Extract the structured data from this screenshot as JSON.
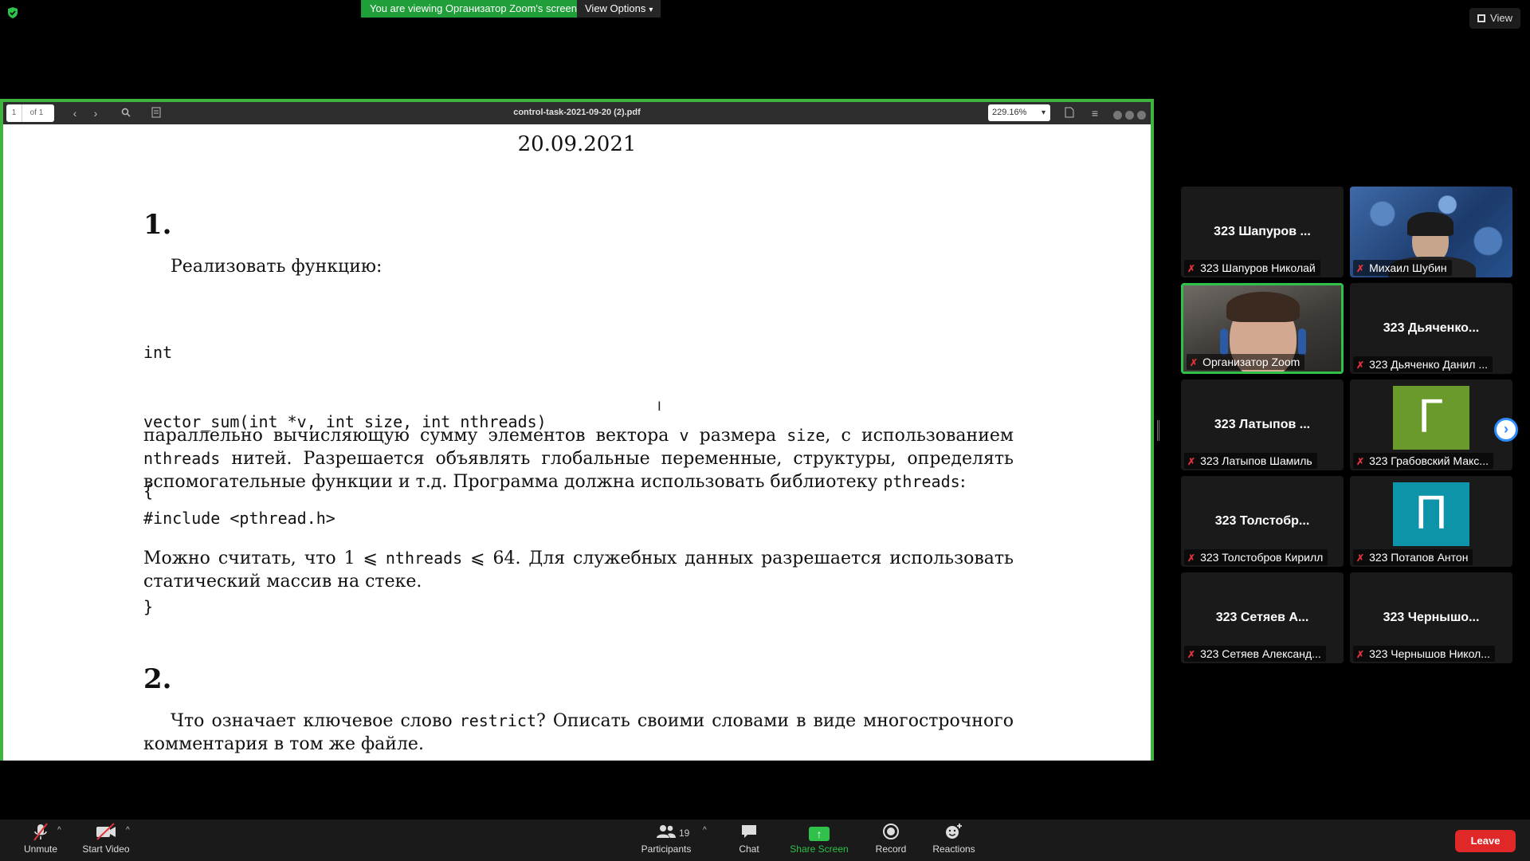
{
  "top": {
    "viewing_text": "You are viewing Организатор Zoom's screen",
    "view_options_label": "View Options",
    "view_label": "View"
  },
  "pdf": {
    "page_current": "1",
    "page_total": "of 1",
    "filename": "control-task-2021-09-20 (2).pdf",
    "zoom": "229.16%",
    "date": "20.09.2021",
    "section1_num": "1.",
    "s1_intro": "Реализовать функцию:",
    "code_sig": [
      "int",
      "vector_sum(int *v, int size, int nthreads)",
      "{",
      "",
      "}"
    ],
    "s1_p1_a": "параллельно вычисляющую сумму элементов вектора ",
    "s1_p1_v": "v",
    "s1_p1_b": " размера ",
    "s1_p1_size": "size",
    "s1_p1_c": ", с использованием ",
    "s1_p1_nthreads": "nthreads",
    "s1_p1_d": " нитей. Разрешается объявлять глобальные переменные, структуры, определять вспомогательные функции и т.д. Программа должна использовать библиотеку ",
    "s1_p1_pthreads": "pthreads",
    "s1_p1_e": ":",
    "include_line": "#include <pthread.h>",
    "s1_p2_a": "Можно считать, что 1 ⩽ ",
    "s1_p2_nthreads": "nthreads",
    "s1_p2_b": " ⩽ 64. Для служебных данных разрешается использовать статический массив на стеке.",
    "section2_num": "2.",
    "s2_p1_a": "Что означает ключевое слово ",
    "s2_p1_restrict": "restrict",
    "s2_p1_b": "? Описать своими словами в виде многострочного комментария в том же файле."
  },
  "gallery": {
    "tiles": [
      {
        "center": "323 Шапуров ...",
        "label": "323 Шапуров Николай"
      },
      {
        "center": "",
        "label": "Михаил Шубин"
      },
      {
        "center": "",
        "label": "Организатор Zoom"
      },
      {
        "center": "323 Дьяченко...",
        "label": "323 Дьяченко Данил ..."
      },
      {
        "center": "323 Латыпов ...",
        "label": "323 Латыпов Шамиль"
      },
      {
        "center": "Г",
        "label": "323 Грабовский Макс..."
      },
      {
        "center": "323 Толстобр...",
        "label": "323 Толстобров Кирилл"
      },
      {
        "center": "П",
        "label": "323 Потапов Антон"
      },
      {
        "center": "323 Сетяев А...",
        "label": "323 Сетяев Александ..."
      },
      {
        "center": "323 Чернышо...",
        "label": "323 Чернышов Никол..."
      }
    ],
    "avatar_colors": {
      "g": "#6a9a2b",
      "p": "#0e94a8"
    }
  },
  "toolbar": {
    "unmute": "Unmute",
    "start_video": "Start Video",
    "participants": "Participants",
    "participants_count": "19",
    "chat": "Chat",
    "share_screen": "Share Screen",
    "record": "Record",
    "reactions": "Reactions",
    "leave": "Leave"
  },
  "colors": {
    "share_border": "#3fb33f",
    "leave": "#e02828",
    "active_speaker": "#2fc14a",
    "banner": "#1f9e3a"
  }
}
